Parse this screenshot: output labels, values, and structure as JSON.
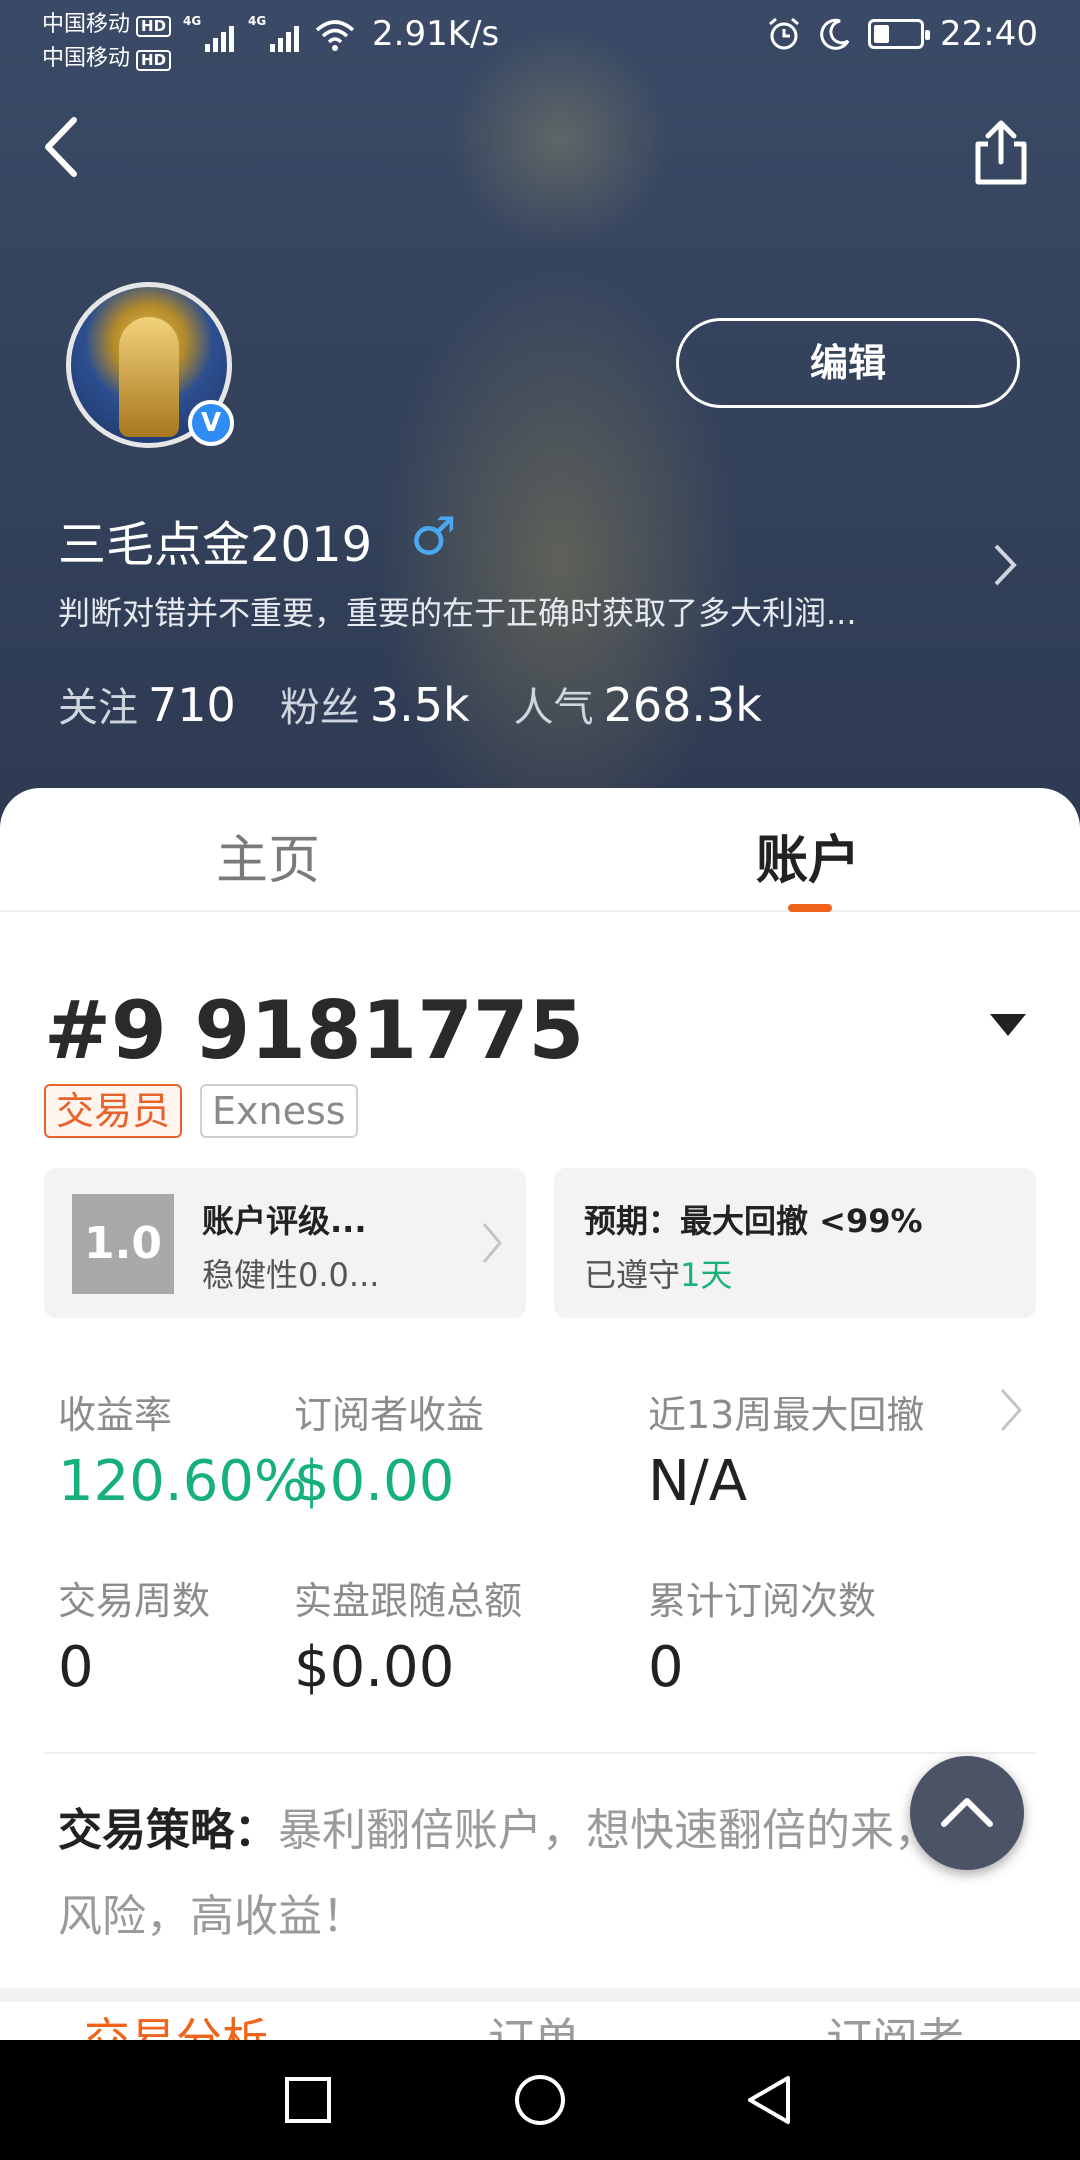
{
  "status_bar": {
    "carrier_1": "中国移动",
    "carrier_2": "中国移动",
    "hd_badge": "HD",
    "net_type": "4G",
    "speed": "2.91K/s",
    "time": "22:40",
    "battery_level": 0.35
  },
  "header": {
    "edit_label": "编辑",
    "username": "三毛点金2019",
    "gender_symbol": "♂",
    "verified_mark": "V",
    "bio": "判断对错并不重要，重要的在于正确时获取了多大利润...",
    "stats": [
      {
        "label": "关注",
        "value": "710"
      },
      {
        "label": "粉丝",
        "value": "3.5k"
      },
      {
        "label": "人气",
        "value": "268.3k"
      }
    ]
  },
  "tabs": {
    "home": "主页",
    "account": "账户"
  },
  "account": {
    "number": "#9 9181775",
    "tag_role": "交易员",
    "tag_broker": "Exness",
    "rating": {
      "score": "1.0",
      "title": "账户评级...",
      "subtitle": "稳健性0.0..."
    },
    "expectation": {
      "title": "预期：最大回撤 <99%",
      "prefix": "已遵守",
      "days": "1天"
    },
    "metrics": {
      "return_label": "收益率",
      "return_value": "120.60%",
      "subscriber_label": "订阅者收益",
      "subscriber_value": "$0.00",
      "drawdown_label": "近13周最大回撤",
      "drawdown_value": "N/A",
      "weeks_label": "交易周数",
      "weeks_value": "0",
      "follow_label": "实盘跟随总额",
      "follow_value": "$0.00",
      "subs_count_label": "累计订阅次数",
      "subs_count_value": "0"
    },
    "strategy": {
      "label": "交易策略：",
      "text": "暴利翻倍账户，想快速翻倍的来，高风险，高收益！"
    },
    "subtabs": [
      "交易分析",
      "订单",
      "订阅者"
    ]
  },
  "colors": {
    "accent": "#f0631a",
    "positive": "#16b07a",
    "header_bg": "#34425c",
    "verified": "#2f8cf2"
  }
}
